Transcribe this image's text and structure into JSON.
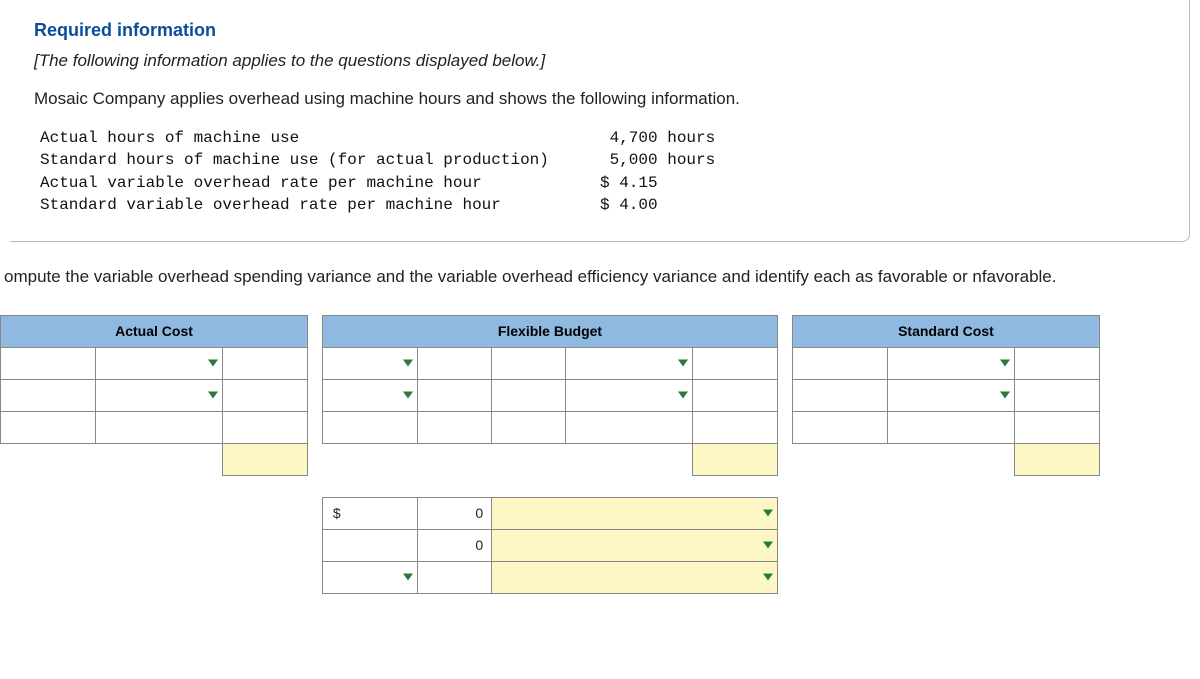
{
  "box": {
    "title": "Required information",
    "subtitle": "[The following information applies to the questions displayed below.]",
    "intro": "Mosaic Company applies overhead using machine hours and shows the following information.",
    "rows": [
      {
        "label": "Actual hours of machine use",
        "value": " 4,700 hours"
      },
      {
        "label": "Standard hours of machine use (for actual production)",
        "value": " 5,000 hours"
      },
      {
        "label": "Actual variable overhead rate per machine hour",
        "value": "$ 4.15"
      },
      {
        "label": "Standard variable overhead rate per machine hour",
        "value": "$ 4.00"
      }
    ]
  },
  "question": "ompute the variable overhead spending variance and the variable overhead efficiency variance and identify each as favorable or nfavorable.",
  "headers": {
    "actual": "Actual Cost",
    "flexible": "Flexible Budget",
    "standard": "Standard Cost"
  },
  "vals": {
    "dollar": "$",
    "zero1": "0",
    "zero2": "0"
  }
}
